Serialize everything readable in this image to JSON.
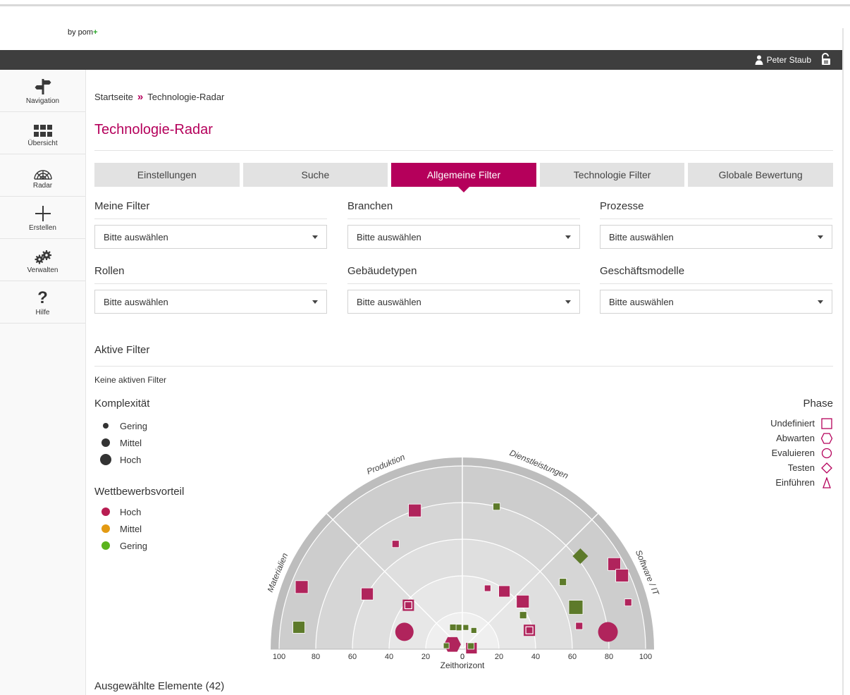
{
  "brand": {
    "by": "by pom",
    "plus": "+"
  },
  "topbar": {
    "user_name": "Peter Staub"
  },
  "sidebar": {
    "items": [
      {
        "label": "Navigation",
        "icon": "signpost-icon"
      },
      {
        "label": "Übersicht",
        "icon": "grid-icon"
      },
      {
        "label": "Radar",
        "icon": "radar-icon"
      },
      {
        "label": "Erstellen",
        "icon": "plus-icon"
      },
      {
        "label": "Verwalten",
        "icon": "gears-icon"
      },
      {
        "label": "Hilfe",
        "icon": "question-icon"
      }
    ]
  },
  "breadcrumb": {
    "home": "Startseite",
    "separator": "»",
    "current": "Technologie-Radar"
  },
  "page_title": "Technologie-Radar",
  "tabs": [
    "Einstellungen",
    "Suche",
    "Allgemeine Filter",
    "Technologie Filter",
    "Globale Bewertung"
  ],
  "active_tab": "Allgemeine Filter",
  "filters": [
    {
      "label": "Meine Filter",
      "value": "Bitte auswählen"
    },
    {
      "label": "Branchen",
      "value": "Bitte auswählen"
    },
    {
      "label": "Prozesse",
      "value": "Bitte auswählen"
    },
    {
      "label": "Rollen",
      "value": "Bitte auswählen"
    },
    {
      "label": "Gebäudetypen",
      "value": "Bitte auswählen"
    },
    {
      "label": "Geschäftsmodelle",
      "value": "Bitte auswählen"
    }
  ],
  "active_filters": {
    "title": "Aktive Filter",
    "empty_text": "Keine aktiven Filter"
  },
  "complexity": {
    "title": "Komplexität",
    "items": [
      "Gering",
      "Mittel",
      "Hoch"
    ]
  },
  "advantage": {
    "title": "Wettbewerbsvorteil",
    "items": [
      {
        "label": "Hoch",
        "color": "#b81d52"
      },
      {
        "label": "Mittel",
        "color": "#e39a13"
      },
      {
        "label": "Gering",
        "color": "#5ab31c"
      }
    ]
  },
  "phase": {
    "title": "Phase",
    "items": [
      "Undefiniert",
      "Abwarten",
      "Evaluieren",
      "Testen",
      "Einführen"
    ]
  },
  "colors": {
    "accent": "#b5005b",
    "marker_high": "#b0245c",
    "marker_low": "#5d7a2a"
  },
  "chart_data": {
    "type": "scatter",
    "sectors": [
      "Materialien",
      "Produktion",
      "Dienstleistungen",
      "Software / IT"
    ],
    "x_ticks_left": [
      "100",
      "80",
      "60",
      "40",
      "20",
      "0"
    ],
    "x_ticks_right": [
      "0",
      "20",
      "40",
      "60",
      "80",
      "100"
    ],
    "xlabel": "Zeithorizont",
    "points": [
      {
        "sector": "Materialien",
        "r": 94,
        "shape": "square",
        "size": 18,
        "color": "marker_high"
      },
      {
        "sector": "Materialien",
        "r": 90,
        "shape": "square",
        "size": 17,
        "color": "marker_low"
      },
      {
        "sector": "Materialien",
        "r": 60,
        "shape": "square",
        "size": 17,
        "color": "marker_high"
      },
      {
        "sector": "Materialien",
        "r": 33,
        "shape": "circle",
        "size": 26,
        "color": "marker_high"
      },
      {
        "sector": "Materialien",
        "r": 38,
        "shape": "square-undefined",
        "size": 16,
        "color": "marker_high"
      },
      {
        "sector": "Materialien",
        "r": 6,
        "shape": "hexagon",
        "size": 24,
        "color": "marker_high"
      },
      {
        "sector": "Materialien",
        "r": 9,
        "shape": "square",
        "size": 8,
        "color": "marker_low"
      },
      {
        "sector": "Produktion",
        "r": 80,
        "shape": "square",
        "size": 18,
        "color": "marker_high"
      },
      {
        "sector": "Produktion",
        "r": 68,
        "shape": "square",
        "size": 10,
        "color": "marker_high"
      },
      {
        "sector": "Produktion",
        "r": 12,
        "shape": "square",
        "size": 9,
        "color": "marker_low"
      },
      {
        "sector": "Produktion",
        "r": 13,
        "shape": "square",
        "size": 9,
        "color": "marker_low"
      },
      {
        "sector": "Dienstleistungen",
        "r": 80,
        "shape": "square",
        "size": 10,
        "color": "marker_low"
      },
      {
        "sector": "Dienstleistungen",
        "r": 39,
        "shape": "square",
        "size": 16,
        "color": "marker_high"
      },
      {
        "sector": "Dienstleistungen",
        "r": 36,
        "shape": "square",
        "size": 9,
        "color": "marker_high"
      },
      {
        "sector": "Dienstleistungen",
        "r": 12,
        "shape": "square",
        "size": 8,
        "color": "marker_low"
      },
      {
        "sector": "Dienstleistungen",
        "r": 12,
        "shape": "square",
        "size": 8,
        "color": "marker_low"
      },
      {
        "sector": "Software / IT",
        "r": 82,
        "shape": "diamond",
        "size": 22,
        "color": "marker_low"
      },
      {
        "sector": "Software / IT",
        "r": 94,
        "shape": "square",
        "size": 10,
        "color": "marker_high"
      },
      {
        "sector": "Software / IT",
        "r": 95,
        "shape": "square",
        "size": 18,
        "color": "marker_high"
      },
      {
        "sector": "Software / IT",
        "r": 80,
        "shape": "circle",
        "size": 28,
        "color": "marker_high"
      },
      {
        "sector": "Software / IT",
        "r": 66,
        "shape": "square",
        "size": 20,
        "color": "marker_low"
      },
      {
        "sector": "Software / IT",
        "r": 66,
        "shape": "square",
        "size": 10,
        "color": "marker_low"
      },
      {
        "sector": "Software / IT",
        "r": 65,
        "shape": "square",
        "size": 10,
        "color": "marker_high"
      },
      {
        "sector": "Software / IT",
        "r": 96,
        "shape": "square",
        "size": 18,
        "color": "marker_high"
      },
      {
        "sector": "Software / IT",
        "r": 42,
        "shape": "square",
        "size": 18,
        "color": "marker_high"
      },
      {
        "sector": "Software / IT",
        "r": 38,
        "shape": "square-undefined",
        "size": 16,
        "color": "marker_high"
      },
      {
        "sector": "Software / IT",
        "r": 38,
        "shape": "square",
        "size": 10,
        "color": "marker_low"
      },
      {
        "sector": "Software / IT",
        "r": 5,
        "shape": "square",
        "size": 16,
        "color": "marker_high"
      },
      {
        "sector": "Software / IT",
        "r": 5,
        "shape": "square",
        "size": 9,
        "color": "marker_low"
      }
    ]
  },
  "selected_elements": {
    "label": "Ausgewählte Elemente (42)"
  }
}
